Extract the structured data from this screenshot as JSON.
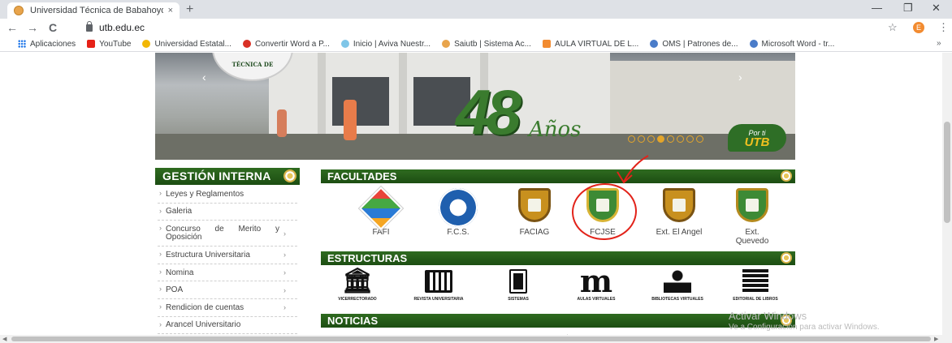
{
  "browser": {
    "tab_title": "Universidad Técnica de Babahoyo",
    "tab_close": "×",
    "new_tab": "+",
    "url": "utb.edu.ec",
    "avatar_letter": "E",
    "window_controls": {
      "minimize": "—",
      "restore": "❐",
      "close": "✕"
    },
    "nav": {
      "back": "←",
      "forward": "→",
      "reload": "C"
    },
    "bookmarks": [
      {
        "label": "Aplicaciones",
        "color": "#1a73e8"
      },
      {
        "label": "YouTube",
        "color": "#e62117"
      },
      {
        "label": "Universidad Estatal...",
        "color": "#f2b705"
      },
      {
        "label": "Convertir Word a P...",
        "color": "#d93025"
      },
      {
        "label": "Inicio | Aviva Nuestr...",
        "color": "#7fc6e8"
      },
      {
        "label": "Saiutb | Sistema Ac...",
        "color": "#e8a44c"
      },
      {
        "label": "AULA VIRTUAL DE L...",
        "color": "#f28b30"
      },
      {
        "label": "OMS | Patrones de...",
        "color": "#4a7cc9"
      },
      {
        "label": "Microsoft Word - tr...",
        "color": "#4a7cc9"
      }
    ],
    "bookmarks_more": "»"
  },
  "banner": {
    "seal_text": "TÉCNICA DE",
    "anniversary_number": "48",
    "anniversary_word": "Años",
    "slide_dots": 8,
    "active_slide": 3,
    "badge_top": "Por ti",
    "badge_main": "UTB",
    "prev": "‹",
    "next": "›"
  },
  "sidebar": {
    "title": "GESTIÓN INTERNA",
    "items": [
      {
        "label": "Leyes y Reglamentos",
        "sub": false
      },
      {
        "label": "Galeria",
        "sub": false
      },
      {
        "label": "Concurso de Merito y Oposición",
        "sub": true
      },
      {
        "label": "Estructura Universitaria",
        "sub": true
      },
      {
        "label": "Nomina",
        "sub": true
      },
      {
        "label": "POA",
        "sub": true
      },
      {
        "label": "Rendicion de cuentas",
        "sub": true
      },
      {
        "label": "Arancel Universitario",
        "sub": false
      }
    ]
  },
  "facultades": {
    "title": "FACULTADES",
    "items": [
      {
        "label": "FAFI"
      },
      {
        "label": "F.C.S."
      },
      {
        "label": "FACIAG"
      },
      {
        "label": "FCJSE"
      },
      {
        "label": "Ext. El Angel"
      },
      {
        "label": "Ext. Quevedo"
      }
    ]
  },
  "estructuras": {
    "title": "ESTRUCTURAS",
    "items": [
      {
        "label": "VICERRECTORADO"
      },
      {
        "label": "REVISTA UNIVERSITARIA"
      },
      {
        "label": "SISTEMAS"
      },
      {
        "label": "AULAS VIRTUALES"
      },
      {
        "label": "BIBLIOTECAS VIRTUALES"
      },
      {
        "label": "EDITORIAL DE LIBROS"
      }
    ]
  },
  "noticias": {
    "title": "NOTICIAS"
  },
  "watermark": {
    "line1": "Activar Windows",
    "line2": "Ve a Configuración para activar Windows."
  }
}
